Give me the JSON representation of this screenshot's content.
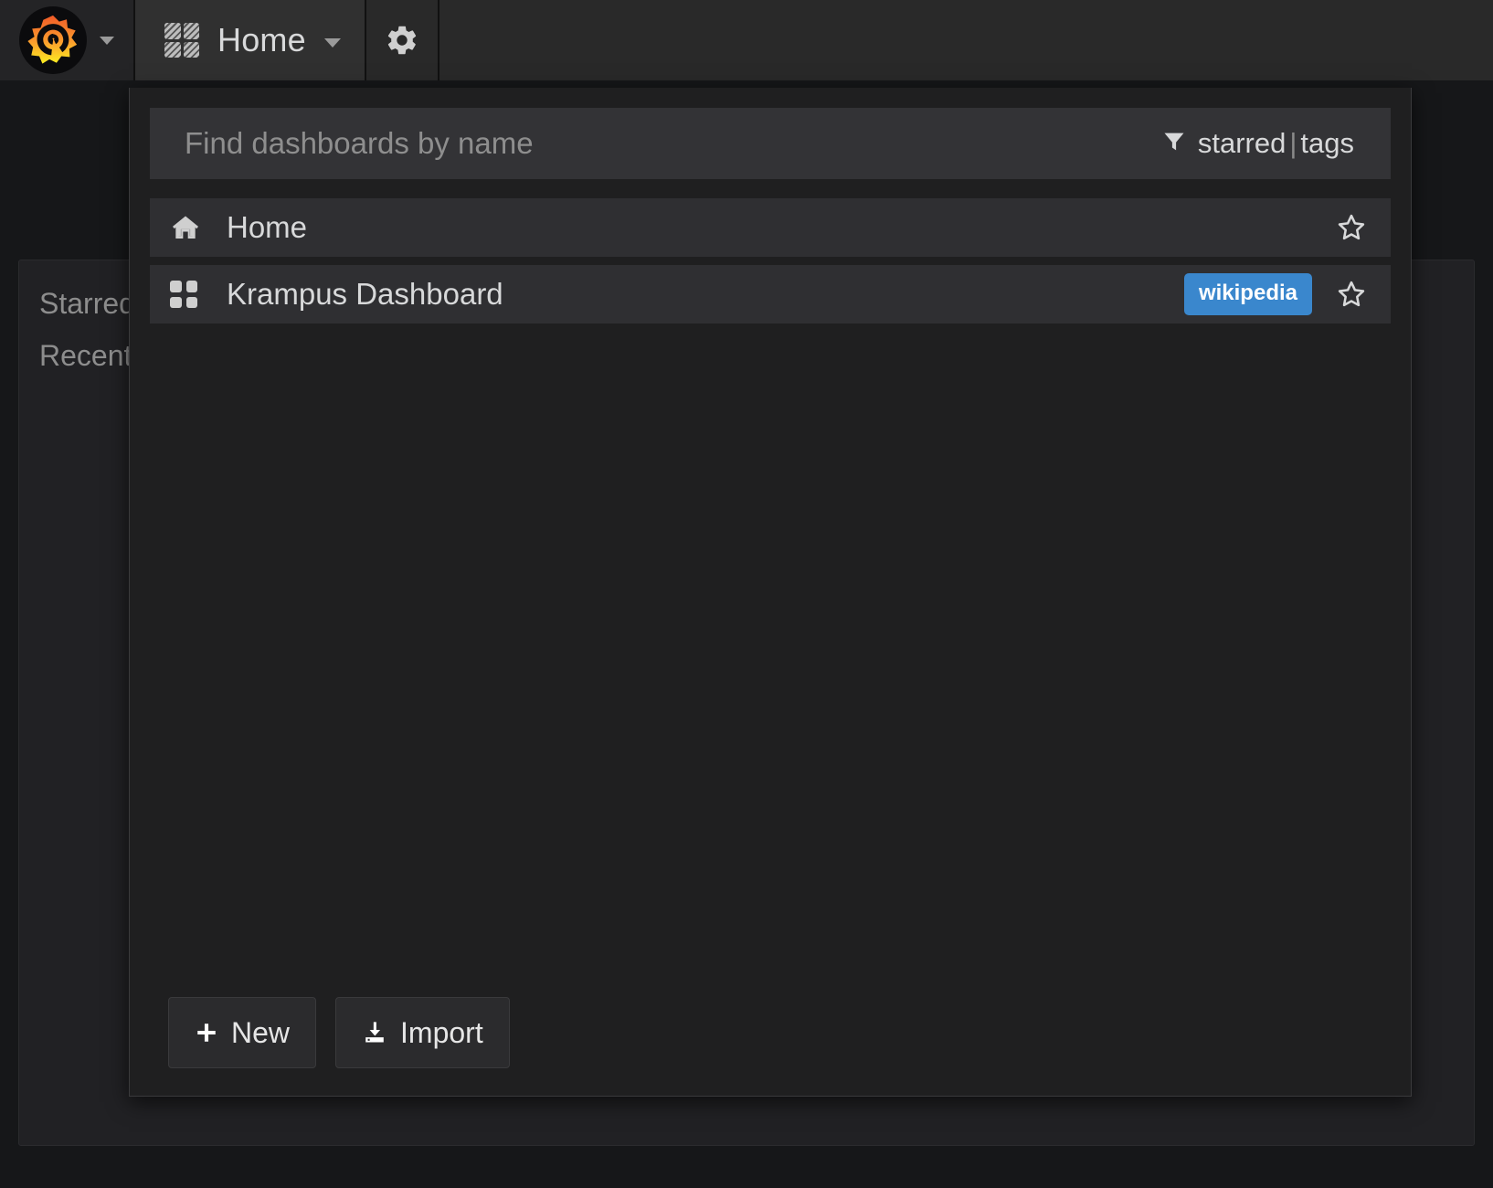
{
  "app": {
    "name": "Grafana",
    "theme_bg": "#161719",
    "accent": "#3a87cd"
  },
  "navbar": {
    "logo_icon": "grafana-logo-icon",
    "logo_caret_icon": "chevron-down-icon",
    "dashboard_icon": "dashboard-grid-icon",
    "title": "Home",
    "title_caret_icon": "chevron-down-icon",
    "settings_icon": "gear-icon"
  },
  "background_page": {
    "sections": [
      {
        "label": "Starred"
      },
      {
        "label": "Recently"
      }
    ]
  },
  "search_dropdown": {
    "search": {
      "placeholder": "Find dashboards by name",
      "value": "",
      "filter_icon": "filter-funnel-icon",
      "starred_label": "starred",
      "separator": "|",
      "tags_label": "tags"
    },
    "results": [
      {
        "icon": "home-icon",
        "title": "Home",
        "tags": [],
        "starred": false,
        "star_icon": "star-outline-icon"
      },
      {
        "icon": "dashboard-grid-icon",
        "title": "Krampus Dashboard",
        "tags": [
          "wikipedia"
        ],
        "starred": false,
        "star_icon": "star-outline-icon"
      }
    ],
    "actions": {
      "new_label": "New",
      "new_icon": "plus-icon",
      "import_label": "Import",
      "import_icon": "import-download-icon"
    }
  }
}
